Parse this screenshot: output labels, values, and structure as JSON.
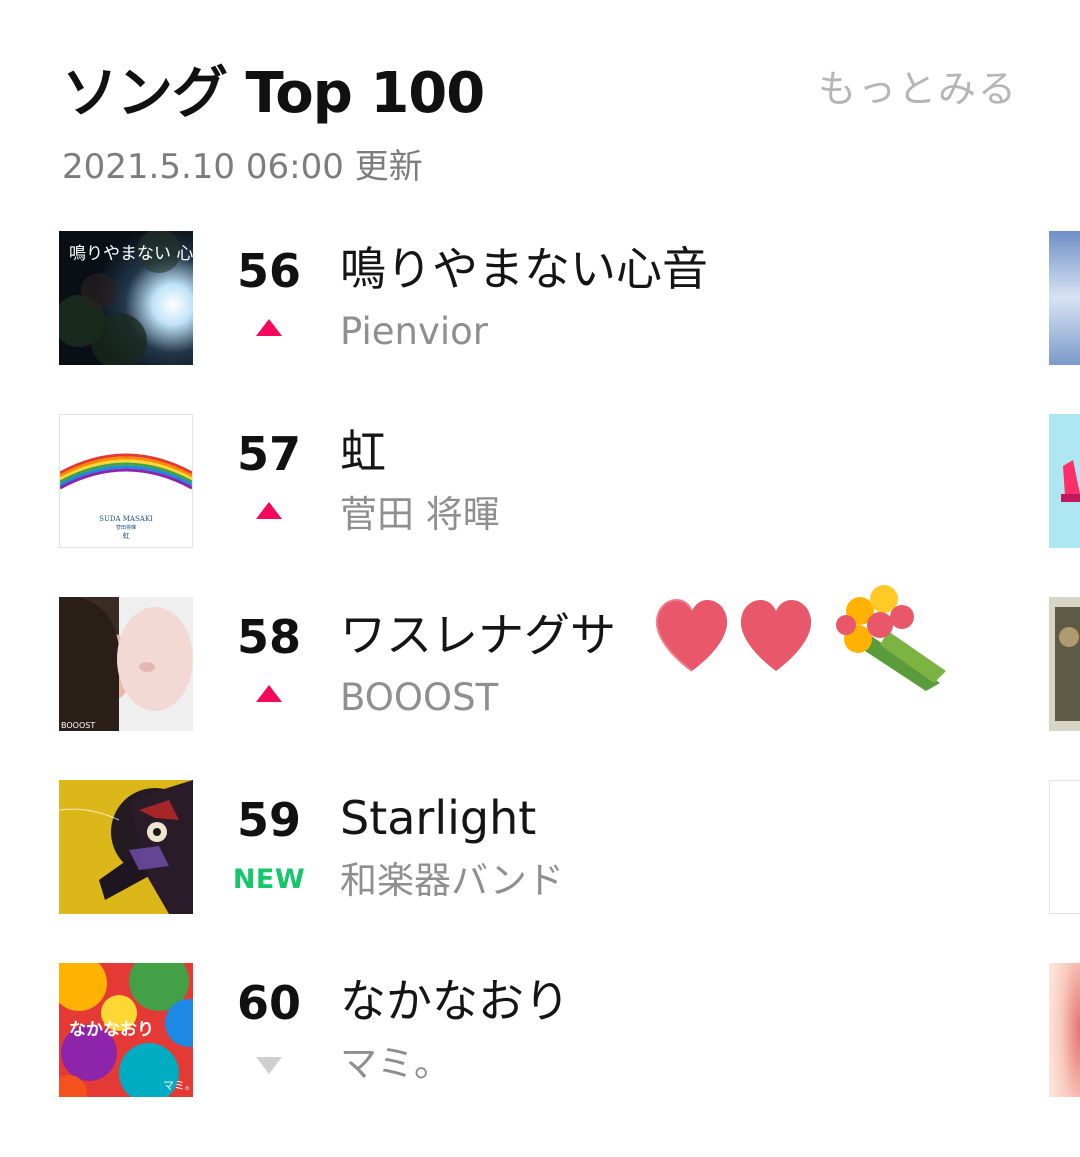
{
  "header": {
    "title": "ソング Top 100",
    "more_label": "もっとみる",
    "updated": "2021.5.10 06:00 更新"
  },
  "colors": {
    "up": "#f3085e",
    "down": "#cfcfcf",
    "new": "#14c86a"
  },
  "songs": [
    {
      "rank": "56",
      "change": "up",
      "title": "鳴りやまない心音",
      "artist": "Pienvior",
      "art_text": "鳴りやまない 心音"
    },
    {
      "rank": "57",
      "change": "up",
      "title": "虹",
      "artist": "菅田 将暉",
      "art_text_line1": "SUDA MASAKI",
      "art_text_line2": "菅田将暉",
      "art_text_line3": "虹"
    },
    {
      "rank": "58",
      "change": "up",
      "title": "ワスレナグサ",
      "artist": "BOOOST",
      "art_text": "BOOOST",
      "decorations": [
        "heart-icon",
        "heart-icon",
        "bouquet-icon"
      ]
    },
    {
      "rank": "59",
      "change": "new",
      "change_label": "NEW",
      "title": "Starlight",
      "artist": "和楽器バンド"
    },
    {
      "rank": "60",
      "change": "down",
      "title": "なかなおり",
      "artist": "マミ。",
      "art_text": "なかなおり",
      "art_text2": "マミ。"
    }
  ]
}
